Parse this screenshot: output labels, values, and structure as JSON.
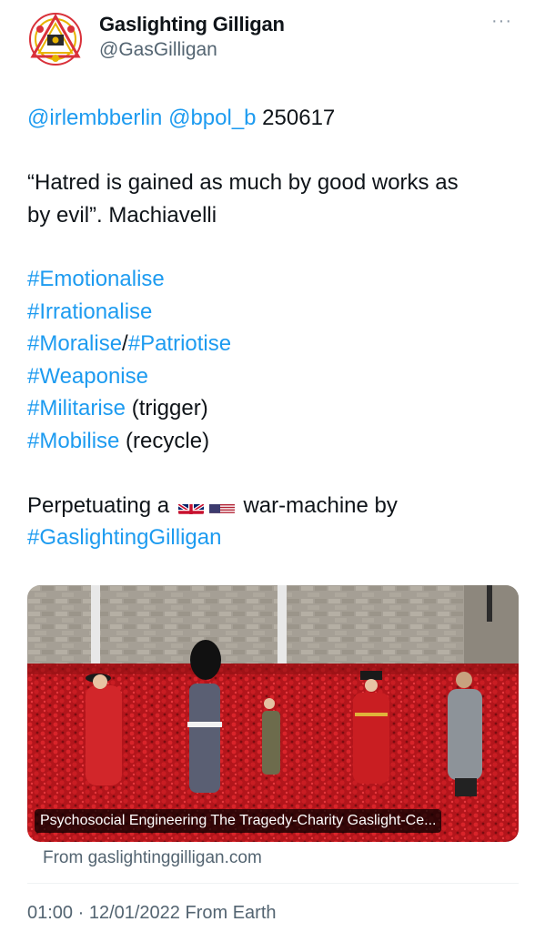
{
  "author": {
    "name": "Gaslighting Gilligan",
    "handle": "@GasGilligan"
  },
  "tweet": {
    "line1": {
      "mention1": "@irlembberlin",
      "mention2": "@bpol_b",
      "text": " 250617"
    },
    "quote_line1": "“Hatred is gained as much by good works as",
    "quote_line2": "by evil”. Machiavelli",
    "hashtags": [
      {
        "tag": "#Emotionalise",
        "suffix": ""
      },
      {
        "tag": "#Irrationalise",
        "suffix": ""
      },
      {
        "tag": "#Moralise",
        "suffix": "/",
        "tag2": "#Patriotise"
      },
      {
        "tag": "#Weaponise",
        "suffix": ""
      },
      {
        "tag": "#Militarise",
        "suffix": " (trigger)"
      },
      {
        "tag": "#Mobilise",
        "suffix": " (recycle)"
      }
    ],
    "closing_prefix": "Perpetuating a",
    "closing_suffix": "war-machine by",
    "closing_hashtag": "#GaslightingGilligan"
  },
  "link_card": {
    "caption": "Psychosocial Engineering The Tragedy-Charity Gaslight-Ce...",
    "source": "From gaslightinggilligan.com"
  },
  "meta": {
    "time": "01:00 · 12/01/2022 From Earth"
  },
  "icons": {
    "more": "more-dots-icon",
    "avatar": "triangle-emblem-logo",
    "flag1": "uk-flag",
    "flag2": "us-flag"
  },
  "colors": {
    "link": "#1d9bf0",
    "text": "#0f1419",
    "secondary": "#536471"
  }
}
